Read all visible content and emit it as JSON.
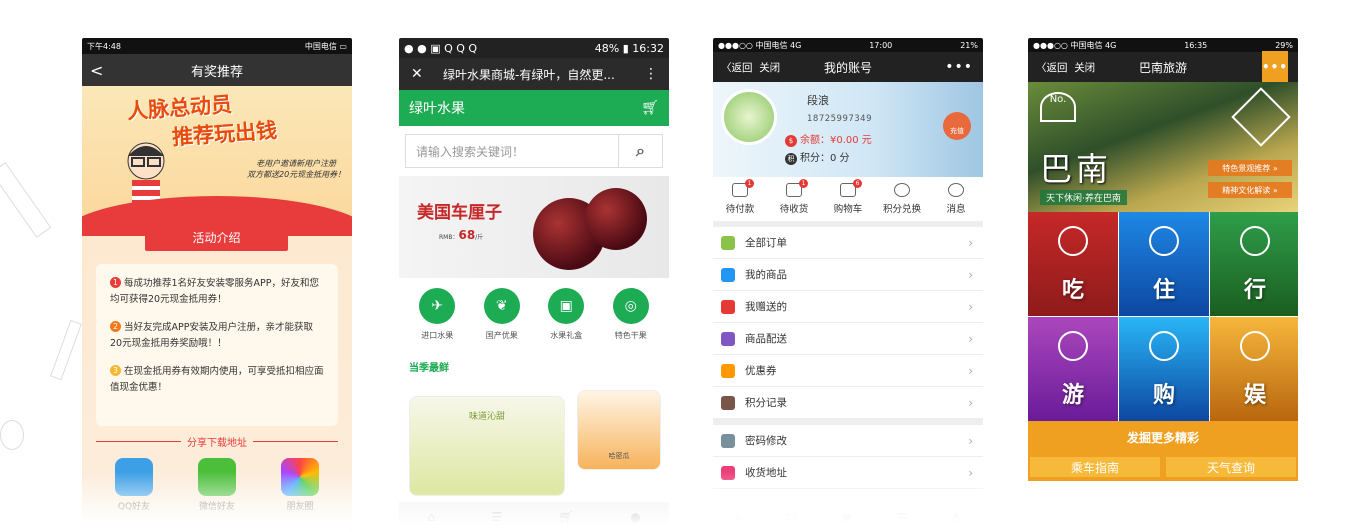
{
  "phone1": {
    "status": {
      "time": "下午4:48",
      "carrier": "中国电信"
    },
    "nav": {
      "back": "<",
      "title": "有奖推荐"
    },
    "banner": {
      "line1": "人脉总动员",
      "line2": "推荐玩出钱",
      "note": "老用户邀请新用户注册\n双方都送20元现金抵用券！"
    },
    "activity_button": "活动介绍",
    "rules": [
      {
        "num": "1",
        "text": "每成功推荐1名好友安装零服务APP，好友和您均可获得20元现金抵用券！"
      },
      {
        "num": "2",
        "text": "当好友完成APP安装及用户注册，亲才能获取20元现金抵用券奖励哦！！"
      },
      {
        "num": "3",
        "text": "在现金抵用券有效期内使用，可享受抵扣相应面值现金优惠！"
      }
    ],
    "share_title": "分享下载地址",
    "share_apps": [
      "QQ好友",
      "微信好友",
      "朋友圈"
    ]
  },
  "phone2": {
    "status": {
      "time": "16:32",
      "battery": "48%"
    },
    "nav": {
      "close": "✕",
      "title": "绿叶水果商城-有绿叶，自然更...",
      "more": "⋮"
    },
    "header": {
      "title": "绿叶水果"
    },
    "search": {
      "placeholder": "请输入搜索关键词！"
    },
    "banner": {
      "title": "美国车厘子",
      "price": "68",
      "unit": "/斤",
      "rmb": "RMB："
    },
    "categories": [
      "进口水果",
      "国产优果",
      "水果礼盒",
      "特色干果"
    ],
    "section_title": "当季最鲜",
    "product_labels": [
      "味道沁甜",
      "哈密瓜"
    ]
  },
  "phone3": {
    "status": {
      "carrier": "●●●○○ 中国电信 4G",
      "time": "17:00",
      "battery": "21%"
    },
    "nav": {
      "back": "〈返回",
      "close": "关闭",
      "title": "我的账号",
      "more": "•••"
    },
    "user": {
      "name": "段浪",
      "phone": "18725997349",
      "balance_label": "余额：",
      "balance": "¥0.00 元",
      "points_label": "积分：",
      "points": "0 分",
      "recharge": "充值",
      "balance_icon": "$",
      "points_icon": "积"
    },
    "orders": [
      {
        "label": "待付款",
        "badge": "1"
      },
      {
        "label": "待收货",
        "badge": "1"
      },
      {
        "label": "购物车",
        "badge": "6"
      },
      {
        "label": "积分兑换",
        "badge": ""
      },
      {
        "label": "消息",
        "badge": ""
      }
    ],
    "menu": [
      "全部订单",
      "我的商品",
      "我赠送的",
      "商品配送",
      "优惠券",
      "积分记录"
    ],
    "menu2": [
      "密码修改",
      "收货地址"
    ],
    "colors": {
      "accent": "#e53935",
      "menu_icons": [
        "#8bc34a",
        "#2196f3",
        "#e53935",
        "#7e57c2",
        "#ff9800",
        "#795548"
      ]
    }
  },
  "phone4": {
    "status": {
      "carrier": "●●●○○ 中国电信 4G",
      "time": "16:35",
      "battery": "29%"
    },
    "nav": {
      "back": "〈返回",
      "close": "关闭",
      "title": "巴南旅游",
      "more": "•••"
    },
    "hero": {
      "big": "巴南",
      "slogan": "天下休闲·养在巴南",
      "tag1": "特色景观推荐 »",
      "tag2": "精神文化解读 »",
      "logo": "No."
    },
    "grid": [
      {
        "label": "吃",
        "color": "#d32f2f"
      },
      {
        "label": "住",
        "color": "#1e88e5"
      },
      {
        "label": "行",
        "color": "#2e9e4a"
      },
      {
        "label": "游",
        "color": "#8e3fa5"
      },
      {
        "label": "购",
        "color": "#1b75bc"
      },
      {
        "label": "娱",
        "color": "#e9a020"
      }
    ],
    "more": "发掘更多精彩",
    "buttons": [
      "乘车指南",
      "天气查询"
    ]
  }
}
